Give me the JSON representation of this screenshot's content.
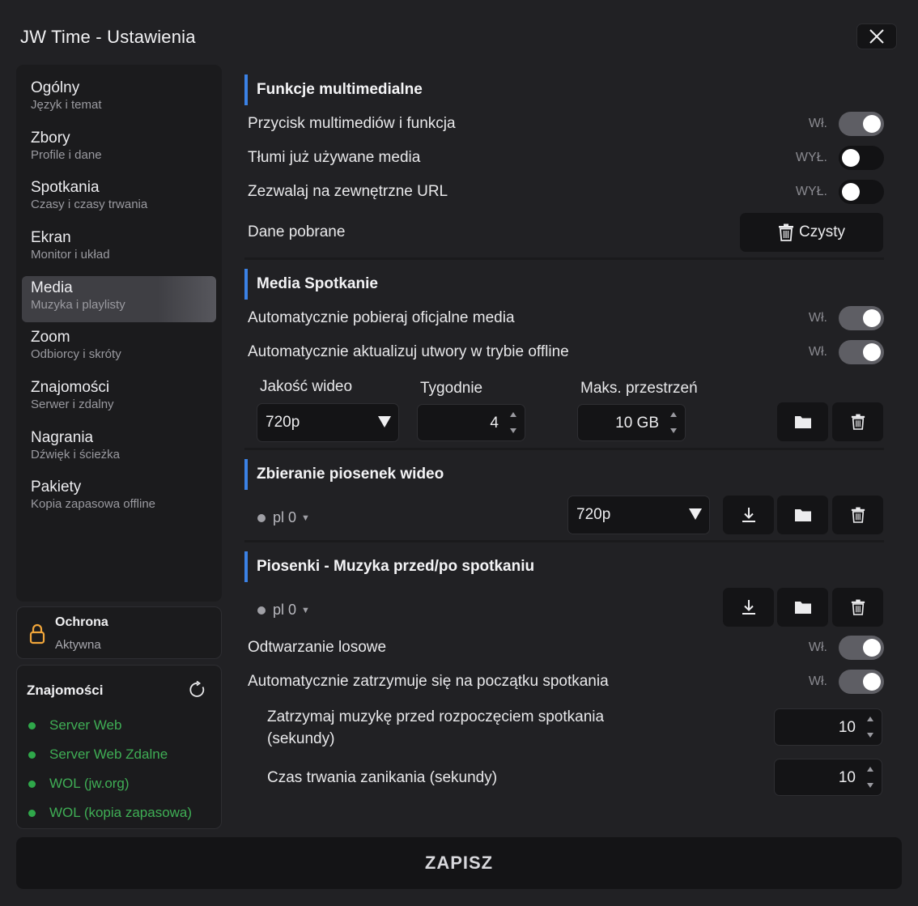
{
  "window": {
    "title": "JW Time - Ustawienia"
  },
  "sidebar": {
    "items": [
      {
        "label": "Ogólny",
        "sub": "Język i temat"
      },
      {
        "label": "Zbory",
        "sub": "Profile i dane"
      },
      {
        "label": "Spotkania",
        "sub": "Czasy i czasy trwania"
      },
      {
        "label": "Ekran",
        "sub": "Monitor i układ"
      },
      {
        "label": "Media",
        "sub": "Muzyka i playlisty"
      },
      {
        "label": "Zoom",
        "sub": "Odbiorcy i skróty"
      },
      {
        "label": "Znajomości",
        "sub": "Serwer i zdalny"
      },
      {
        "label": "Nagrania",
        "sub": "Dźwięk i ścieżka"
      },
      {
        "label": "Pakiety",
        "sub": "Kopia zapasowa offline"
      }
    ],
    "active_index": 4
  },
  "protection": {
    "title": "Ochrona",
    "status": "Aktywna"
  },
  "connections": {
    "title": "Znajomości",
    "items": [
      "Server Web",
      "Server Web Zdalne",
      "WOL (jw.org)",
      "WOL (kopia zapasowa)"
    ]
  },
  "sections": {
    "multimedia": {
      "title": "Funkcje multimedialne",
      "rows": [
        {
          "label": "Przycisk multimediów i funkcja",
          "state": "Wł.",
          "on": true
        },
        {
          "label": "Tłumi już używane media",
          "state": "WYŁ.",
          "on": false
        },
        {
          "label": "Zezwalaj na zewnętrzne URL",
          "state": "WYŁ.",
          "on": false
        }
      ],
      "downloaded_label": "Dane pobrane",
      "clear_label": "Czysty"
    },
    "meeting_media": {
      "title": "Media Spotkanie",
      "rows": [
        {
          "label": "Automatycznie pobieraj oficjalne media",
          "state": "Wł.",
          "on": true
        },
        {
          "label": "Automatycznie aktualizuj utwory w trybie offline",
          "state": "Wł.",
          "on": true
        }
      ],
      "quality_label": "Jakość wideo",
      "quality_value": "720p",
      "weeks_label": "Tygodnie",
      "weeks_value": "4",
      "space_label": "Maks. przestrzeń",
      "space_value": "10 GB"
    },
    "song_videos": {
      "title": "Zbieranie piosenek wideo",
      "lang": "pl 0",
      "quality_value": "720p"
    },
    "songs_music": {
      "title": "Piosenki - Muzyka przed/po spotkaniu",
      "lang": "pl 0",
      "rows": [
        {
          "label": "Odtwarzanie losowe",
          "state": "Wł.",
          "on": true
        },
        {
          "label": "Automatycznie zatrzymuje się na początku spotkania",
          "state": "Wł.",
          "on": true
        }
      ],
      "stop_before_label_1": "Zatrzymaj muzykę przed rozpoczęciem spotkania",
      "stop_before_label_2": "(sekundy)",
      "stop_before_value": "10",
      "fade_label": "Czas trwania zanikania (sekundy)",
      "fade_value": "10"
    }
  },
  "save_label": "ZAPISZ"
}
